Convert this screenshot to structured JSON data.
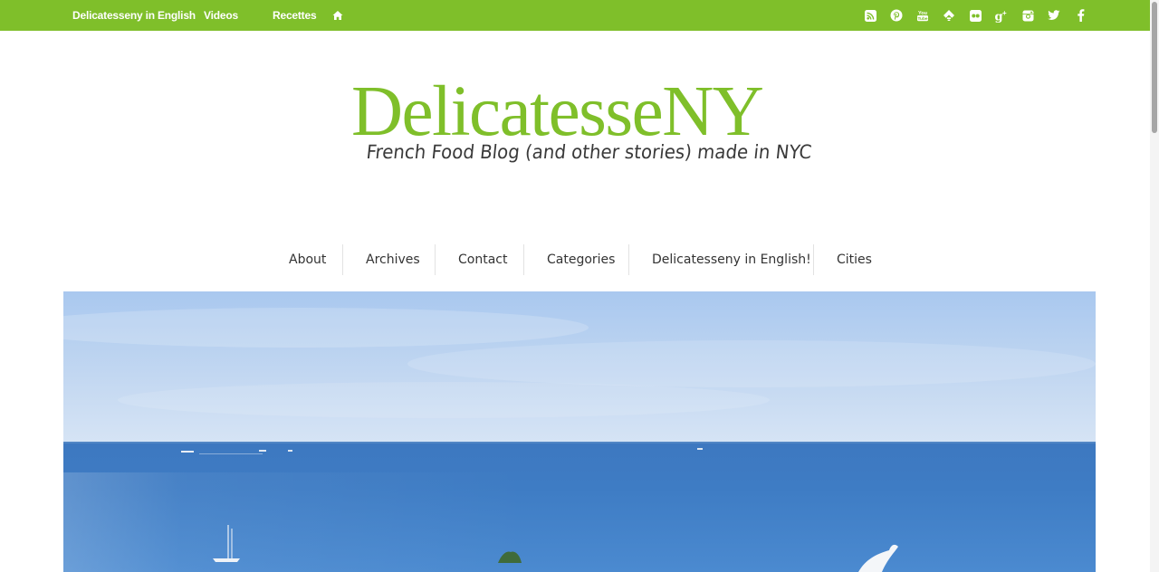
{
  "topbar": {
    "nav": [
      "Delicatesseny in English",
      "Videos",
      "Recettes"
    ],
    "home_icon": "home-icon",
    "social_icons": [
      "rss-icon",
      "pinterest-icon",
      "youtube-icon",
      "feedly-icon",
      "flickr-icon",
      "google-plus-icon",
      "instagram-icon",
      "twitter-icon",
      "facebook-icon"
    ],
    "color": "#7fbf2a"
  },
  "logo": {
    "title": "DelicatesseNY",
    "tagline": "French Food Blog (and other stories) made in NYC",
    "color": "#7fbf2a"
  },
  "mainnav": {
    "items": [
      "About",
      "Archives",
      "Contact",
      "Categories",
      "Delicatesseny in English!",
      "Cities"
    ]
  },
  "hero": {
    "image": "sea-view-photo"
  }
}
